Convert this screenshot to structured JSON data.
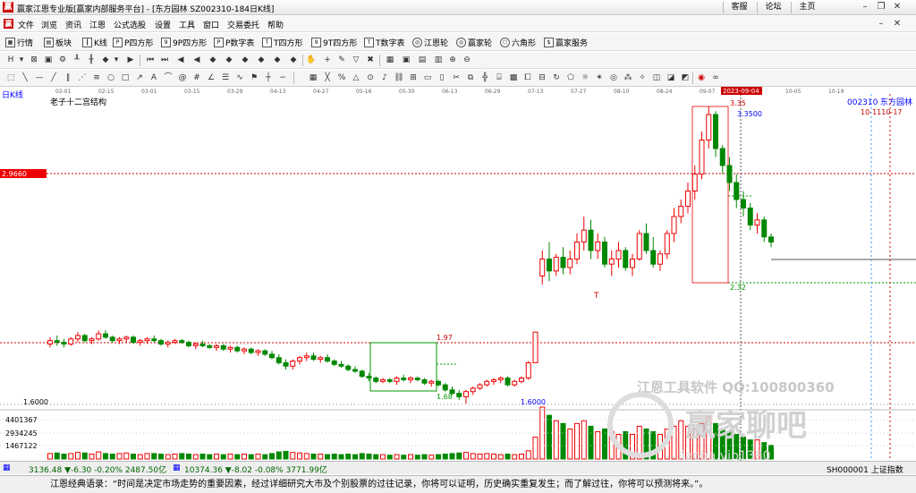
{
  "window": {
    "title": "赢家江恩专业版[赢家内部服务平台] - [东方园林  SZ002310-184日K线]",
    "buttons": [
      "客服",
      "论坛",
      "主页"
    ],
    "logo_text": "赢"
  },
  "menu": [
    "文件",
    "浏览",
    "资讯",
    "江恩",
    "公式选股",
    "设置",
    "工具",
    "窗口",
    "交易委托",
    "帮助"
  ],
  "toolbar": [
    "行情",
    "板块",
    "K线",
    "P四方形",
    "9P四方形",
    "P数字表",
    "T四方形",
    "9T四方形",
    "T数字表",
    "江恩轮",
    "赢家轮",
    "六角形",
    "赢家服务"
  ],
  "chart": {
    "period_label": "日K线",
    "structure_label": "老子十二宫结构",
    "stock_code": "002310",
    "stock_name": "东方园林",
    "date_markers": "10-1110-17",
    "date_axis": [
      "02-01",
      "02-15",
      "03-01",
      "03-15",
      "03-29",
      "04-13",
      "04-27",
      "05-16",
      "05-30",
      "06-13",
      "06-29",
      "07-13",
      "07-27",
      "08-10",
      "08-24",
      "09-07",
      "09-21",
      "10-05",
      "10-19"
    ],
    "highlight_date": "2023-09-04",
    "price_tag": "2.9660",
    "labels": {
      "high_top": "3.35",
      "high_val": "3.3500",
      "box2_low": "2.32",
      "box1_top": "1.97",
      "box1_low": "1.68",
      "low_val": "1.6000",
      "axis_low": "1.6000"
    },
    "volume_axis": [
      "4401367",
      "2934245",
      "1467122"
    ],
    "watermark_1": "江恩工具软件  QQ:100800360",
    "watermark_2": "赢家聊吧",
    "watermark_3": "liaoba.vip1380"
  },
  "status": {
    "sh": "3136.48 ▼-6.30 -0.20% 2487.50亿",
    "sz": "10374.36 ▼-8.02 -0.08% 3771.99亿",
    "index": "SH000001 上证指数"
  },
  "quote": "江恩经典语录：“时间是决定市场走势的重要因素，经过详细研究大市及个别股票的过往记录，你将可以证明，历史确实重复发生；而了解过往，你将可以预测将来。”。",
  "chart_data": {
    "type": "candlestick",
    "title": "东方园林 002310 日K线",
    "price_range": [
      1.6,
      3.35
    ],
    "candles": [
      [
        1.95,
        1.99,
        1.93,
        1.97
      ],
      [
        1.97,
        2.0,
        1.94,
        1.96
      ],
      [
        1.96,
        1.98,
        1.93,
        1.95
      ],
      [
        1.95,
        1.99,
        1.94,
        1.98
      ],
      [
        1.98,
        2.02,
        1.96,
        2.0
      ],
      [
        2.0,
        2.01,
        1.96,
        1.97
      ],
      [
        1.97,
        1.99,
        1.95,
        1.98
      ],
      [
        1.98,
        2.03,
        1.97,
        2.01
      ],
      [
        2.01,
        2.03,
        1.98,
        1.99
      ],
      [
        1.99,
        2.0,
        1.96,
        1.97
      ],
      [
        1.97,
        1.99,
        1.95,
        1.98
      ],
      [
        1.98,
        2.0,
        1.96,
        1.99
      ],
      [
        1.99,
        2.0,
        1.95,
        1.96
      ],
      [
        1.96,
        1.98,
        1.94,
        1.97
      ],
      [
        1.97,
        1.99,
        1.95,
        1.98
      ],
      [
        1.98,
        2.0,
        1.96,
        1.97
      ],
      [
        1.97,
        1.98,
        1.94,
        1.95
      ],
      [
        1.95,
        1.97,
        1.93,
        1.96
      ],
      [
        1.96,
        1.98,
        1.95,
        1.97
      ],
      [
        1.97,
        1.98,
        1.95,
        1.96
      ],
      [
        1.96,
        1.97,
        1.93,
        1.94
      ],
      [
        1.94,
        1.96,
        1.92,
        1.95
      ],
      [
        1.95,
        1.97,
        1.93,
        1.94
      ],
      [
        1.94,
        1.95,
        1.92,
        1.93
      ],
      [
        1.93,
        1.95,
        1.91,
        1.94
      ],
      [
        1.94,
        1.95,
        1.91,
        1.92
      ],
      [
        1.92,
        1.94,
        1.9,
        1.93
      ],
      [
        1.93,
        1.94,
        1.9,
        1.91
      ],
      [
        1.91,
        1.93,
        1.89,
        1.92
      ],
      [
        1.92,
        1.93,
        1.89,
        1.9
      ],
      [
        1.9,
        1.92,
        1.88,
        1.91
      ],
      [
        1.91,
        1.92,
        1.88,
        1.89
      ],
      [
        1.89,
        1.91,
        1.86,
        1.87
      ],
      [
        1.87,
        1.89,
        1.83,
        1.84
      ],
      [
        1.84,
        1.86,
        1.8,
        1.82
      ],
      [
        1.82,
        1.86,
        1.8,
        1.85
      ],
      [
        1.85,
        1.88,
        1.83,
        1.87
      ],
      [
        1.87,
        1.9,
        1.85,
        1.88
      ],
      [
        1.88,
        1.9,
        1.85,
        1.86
      ],
      [
        1.86,
        1.88,
        1.84,
        1.87
      ],
      [
        1.87,
        1.89,
        1.84,
        1.85
      ],
      [
        1.85,
        1.86,
        1.82,
        1.83
      ],
      [
        1.83,
        1.85,
        1.81,
        1.82
      ],
      [
        1.82,
        1.83,
        1.79,
        1.8
      ],
      [
        1.8,
        1.82,
        1.78,
        1.79
      ],
      [
        1.79,
        1.8,
        1.75,
        1.76
      ],
      [
        1.76,
        1.78,
        1.73,
        1.75
      ],
      [
        1.75,
        1.76,
        1.72,
        1.73
      ],
      [
        1.73,
        1.75,
        1.72,
        1.74
      ],
      [
        1.74,
        1.75,
        1.72,
        1.73
      ],
      [
        1.73,
        1.76,
        1.71,
        1.75
      ],
      [
        1.75,
        1.77,
        1.73,
        1.74
      ],
      [
        1.74,
        1.76,
        1.72,
        1.75
      ],
      [
        1.75,
        1.76,
        1.73,
        1.74
      ],
      [
        1.74,
        1.75,
        1.71,
        1.72
      ],
      [
        1.72,
        1.74,
        1.7,
        1.73
      ],
      [
        1.73,
        1.74,
        1.7,
        1.71
      ],
      [
        1.71,
        1.72,
        1.67,
        1.68
      ],
      [
        1.68,
        1.7,
        1.65,
        1.66
      ],
      [
        1.66,
        1.68,
        1.62,
        1.64
      ],
      [
        1.64,
        1.68,
        1.6,
        1.67
      ],
      [
        1.67,
        1.7,
        1.65,
        1.69
      ],
      [
        1.69,
        1.72,
        1.68,
        1.71
      ],
      [
        1.71,
        1.74,
        1.7,
        1.73
      ],
      [
        1.73,
        1.75,
        1.71,
        1.74
      ],
      [
        1.74,
        1.76,
        1.72,
        1.75
      ],
      [
        1.75,
        1.76,
        1.7,
        1.71
      ],
      [
        1.71,
        1.74,
        1.7,
        1.73
      ],
      [
        1.73,
        1.76,
        1.72,
        1.75
      ],
      [
        1.75,
        1.85,
        1.74,
        1.84
      ],
      [
        1.84,
        2.02,
        1.84,
        2.02
      ],
      [
        2.35,
        2.5,
        2.3,
        2.45
      ],
      [
        2.45,
        2.55,
        2.32,
        2.38
      ],
      [
        2.38,
        2.48,
        2.35,
        2.46
      ],
      [
        2.46,
        2.52,
        2.36,
        2.4
      ],
      [
        2.4,
        2.5,
        2.36,
        2.45
      ],
      [
        2.45,
        2.6,
        2.42,
        2.55
      ],
      [
        2.55,
        2.7,
        2.5,
        2.62
      ],
      [
        2.62,
        2.68,
        2.45,
        2.5
      ],
      [
        2.5,
        2.6,
        2.45,
        2.55
      ],
      [
        2.55,
        2.58,
        2.4,
        2.42
      ],
      [
        2.42,
        2.5,
        2.35,
        2.45
      ],
      [
        2.45,
        2.55,
        2.4,
        2.5
      ],
      [
        2.5,
        2.52,
        2.38,
        2.4
      ],
      [
        2.4,
        2.48,
        2.35,
        2.45
      ],
      [
        2.45,
        2.62,
        2.44,
        2.6
      ],
      [
        2.6,
        2.66,
        2.48,
        2.5
      ],
      [
        2.5,
        2.58,
        2.4,
        2.42
      ],
      [
        2.42,
        2.5,
        2.38,
        2.48
      ],
      [
        2.48,
        2.62,
        2.45,
        2.6
      ],
      [
        2.6,
        2.75,
        2.55,
        2.7
      ],
      [
        2.7,
        2.8,
        2.66,
        2.76
      ],
      [
        2.76,
        2.9,
        2.72,
        2.85
      ],
      [
        2.85,
        3.0,
        2.8,
        2.95
      ],
      [
        2.95,
        3.2,
        2.92,
        3.15
      ],
      [
        3.15,
        3.35,
        3.1,
        3.3
      ],
      [
        3.3,
        3.32,
        3.05,
        3.1
      ],
      [
        3.1,
        3.12,
        2.95,
        3.0
      ],
      [
        3.0,
        3.05,
        2.85,
        2.9
      ],
      [
        2.9,
        2.95,
        2.75,
        2.8
      ],
      [
        2.8,
        2.85,
        2.7,
        2.75
      ],
      [
        2.75,
        2.78,
        2.62,
        2.65
      ],
      [
        2.65,
        2.72,
        2.6,
        2.68
      ],
      [
        2.68,
        2.7,
        2.55,
        2.58
      ],
      [
        2.58,
        2.6,
        2.52,
        2.55
      ]
    ],
    "volumes": [
      1.0,
      1.1,
      0.9,
      1.0,
      1.2,
      1.1,
      0.9,
      1.3,
      1.0,
      0.9,
      1.0,
      1.1,
      0.9,
      0.8,
      1.0,
      1.0,
      0.9,
      0.8,
      0.9,
      1.0,
      0.9,
      0.8,
      0.9,
      0.8,
      0.9,
      0.8,
      0.9,
      0.8,
      0.9,
      0.8,
      0.9,
      0.8,
      1.0,
      1.3,
      1.4,
      1.2,
      1.1,
      1.0,
      0.9,
      0.9,
      0.8,
      0.9,
      0.8,
      0.9,
      0.8,
      1.0,
      0.9,
      0.8,
      0.8,
      0.7,
      0.8,
      0.7,
      0.8,
      0.7,
      0.8,
      0.7,
      0.8,
      0.9,
      1.0,
      1.1,
      1.2,
      1.0,
      0.9,
      1.0,
      0.9,
      0.8,
      0.9,
      0.8,
      0.9,
      1.5,
      4.0,
      9.5,
      8.0,
      7.0,
      6.5,
      5.5,
      6.5,
      7.0,
      6.0,
      5.0,
      5.5,
      5.0,
      4.5,
      5.0,
      4.5,
      6.0,
      5.5,
      5.0,
      4.5,
      5.5,
      6.0,
      7.0,
      6.0,
      5.5,
      6.5,
      7.5,
      6.5,
      5.5,
      5.0,
      4.5,
      4.0,
      3.5,
      3.5,
      3.0,
      2.5
    ]
  }
}
